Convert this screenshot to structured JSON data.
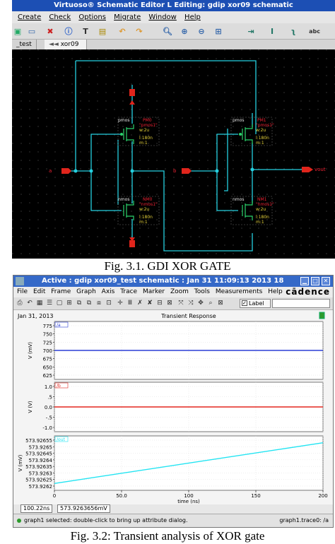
{
  "fig1": {
    "title": "Virtuoso® Schematic Editor L Editing: gdip xor09 schematic",
    "menu": [
      "Create",
      "Check",
      "Options",
      "Migrate",
      "Window",
      "Help"
    ],
    "tabs": [
      "_test",
      "xor09"
    ],
    "toolbar_icons": [
      "save-icon",
      "open-icon",
      "delete-icon",
      "info-icon",
      "text-icon",
      "window-icon",
      "undo-icon",
      "redo-icon",
      "zoom-icon",
      "zoom-in-icon",
      "zoom-out-icon",
      "fit-icon",
      "stretch-icon",
      "wire-icon",
      "wire-narrow-icon",
      "abc-icon"
    ],
    "schematic": {
      "pmos_left": {
        "type": "pmos",
        "model": "PM0",
        "value": "\"pmos1\"",
        "w": "w:2u",
        "l": "l:180n",
        "m": "m:1"
      },
      "nmos_left": {
        "type": "nmos",
        "model": "NM0",
        "value": "\"nmos1\"",
        "w": "w:2u",
        "l": "l:180n",
        "m": "m:1"
      },
      "pmos_right": {
        "type": "pmos",
        "model": "PM1",
        "value": "\"pmos1\"",
        "w": "w:2u",
        "l": "l:180n",
        "m": "m:1"
      },
      "nmos_right": {
        "type": "nmos",
        "model": "NM1",
        "value": "\"nmos1\"",
        "w": "w:2u",
        "l": "l:180n",
        "m": "m:1"
      },
      "pin_a": "a",
      "pin_b": "b",
      "pin_out": "vout"
    }
  },
  "caption1": "Fig. 3.1. GDI XOR GATE",
  "fig2": {
    "title": "Active : gdip xor09_test schematic : Jan 31 11:09:13 2013 18",
    "menu": [
      "File",
      "Edit",
      "Frame",
      "Graph",
      "Axis",
      "Trace",
      "Marker",
      "Zoom",
      "Tools",
      "Measurements",
      "Help"
    ],
    "brand": "cādence",
    "label_button": "Label",
    "date": "Jan 31, 2013",
    "plot_title": "Transient Response",
    "status": "graph1 selected: double-click to bring up attribute dialog.",
    "status_right": "graph1.trace0: /a",
    "readout_time": "100.22ns",
    "readout_value": "573.9263656mV",
    "colors": {
      "trace_a": "#2b3fd6",
      "trace_b": "#e3261f",
      "trace_out": "#22e4f2"
    }
  },
  "chart_data": [
    {
      "type": "line",
      "title": "Transient Response",
      "series": [
        {
          "name": "/a",
          "x": [
            0,
            200
          ],
          "y": [
            700,
            700
          ]
        }
      ],
      "ylabel": "V (mV)",
      "yticks": [
        "775",
        "750",
        "725",
        "700",
        "675",
        "650",
        "625"
      ],
      "ylim": [
        625,
        775
      ],
      "xlim": [
        0,
        200
      ]
    },
    {
      "type": "line",
      "series": [
        {
          "name": "/b",
          "x": [
            0,
            200
          ],
          "y": [
            0,
            0
          ]
        }
      ],
      "ylabel": "V (V)",
      "yticks": [
        "1.0",
        ".5",
        "0.0",
        "-.5",
        "-1.0"
      ],
      "ylim": [
        -1,
        1
      ],
      "xlim": [
        0,
        200
      ]
    },
    {
      "type": "line",
      "series": [
        {
          "name": "/out",
          "x": [
            0,
            200
          ],
          "y": [
            573.92622,
            573.92653
          ]
        }
      ],
      "ylabel": "V (mV)",
      "yticks": [
        "573.92655",
        "573.9265",
        "573.92645",
        "573.9264",
        "573.92635",
        "573.9263",
        "573.92625",
        "573.9262"
      ],
      "ylim": [
        573.9262,
        573.92655
      ],
      "xlabel": "time (ns)",
      "xticks": [
        "0",
        "50.0",
        "100",
        "150",
        "200"
      ],
      "xlim": [
        0,
        200
      ],
      "grid": true
    }
  ],
  "caption2": "Fig. 3.2: Transient analysis of XOR gate"
}
